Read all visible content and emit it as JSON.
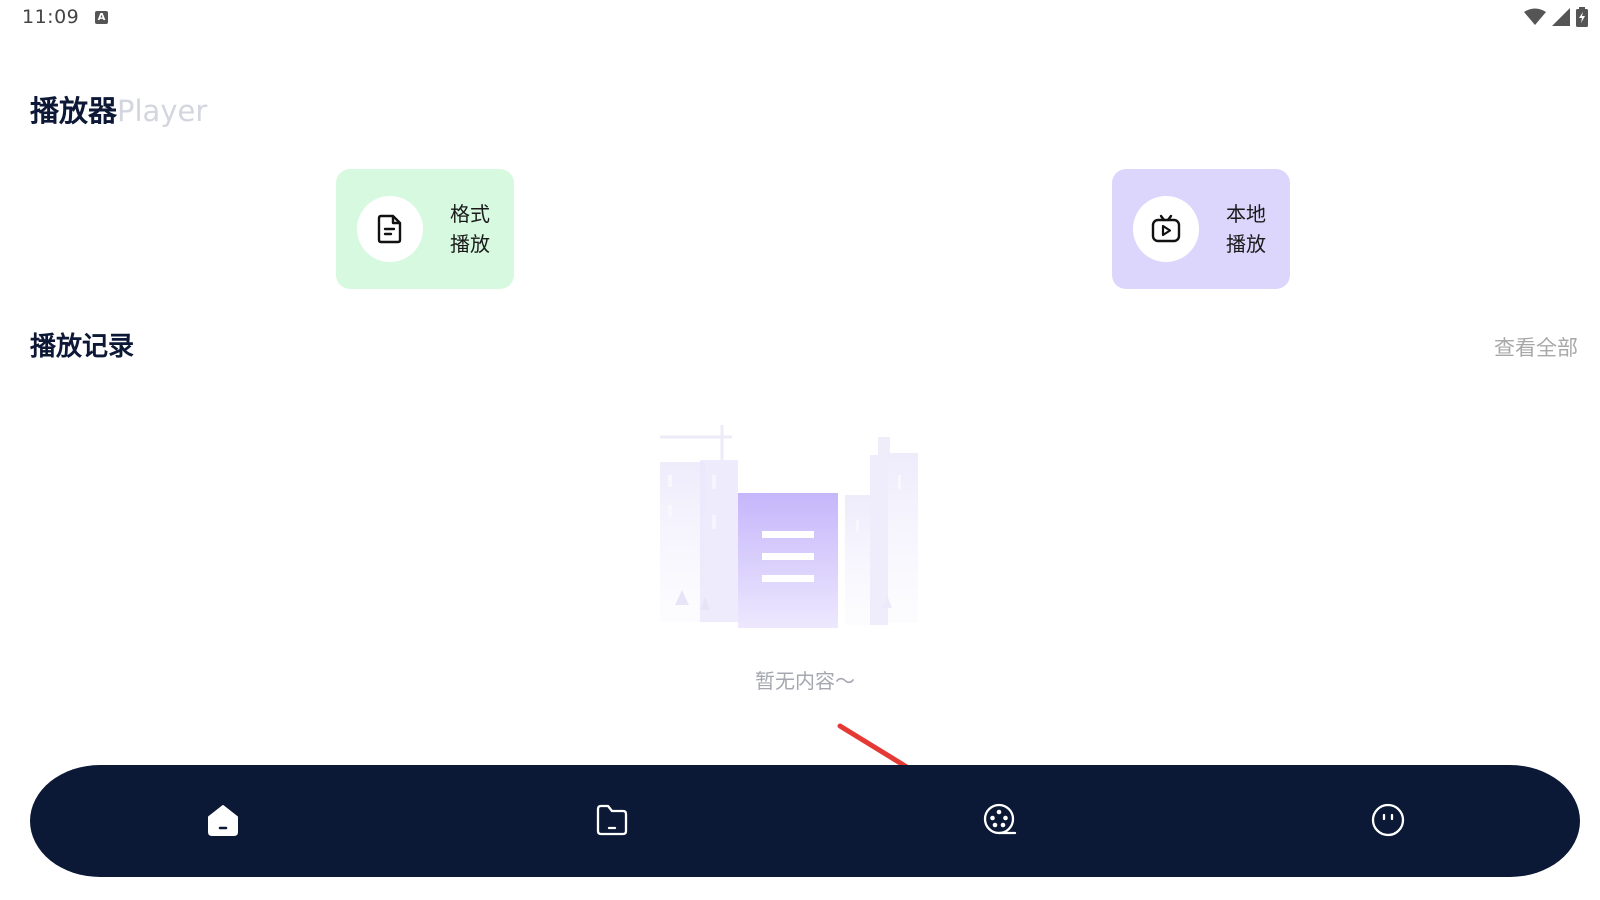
{
  "status_bar": {
    "time": "11:09",
    "notification_icon": "a-icon",
    "icons": [
      "wifi-icon",
      "signal-icon",
      "battery-icon"
    ]
  },
  "header": {
    "title_cn": "播放器",
    "title_en": "Player"
  },
  "quick_actions": [
    {
      "label_line1": "格式",
      "label_line2": "播放",
      "icon": "document-icon",
      "color": "#d6f9e0"
    },
    {
      "label_line1": "本地",
      "label_line2": "播放",
      "icon": "tv-play-icon",
      "color": "#ddd6fc"
    }
  ],
  "history": {
    "title": "播放记录",
    "view_all": "查看全部",
    "empty_text": "暂无内容～"
  },
  "bottom_nav": {
    "background": "#0b1936",
    "items": [
      {
        "name": "home",
        "icon": "home-icon",
        "active": true
      },
      {
        "name": "files",
        "icon": "folder-icon",
        "active": false
      },
      {
        "name": "player",
        "icon": "film-reel-icon",
        "active": false
      },
      {
        "name": "profile",
        "icon": "smile-icon",
        "active": false
      }
    ]
  },
  "annotation": {
    "arrow_color": "#e53935"
  }
}
